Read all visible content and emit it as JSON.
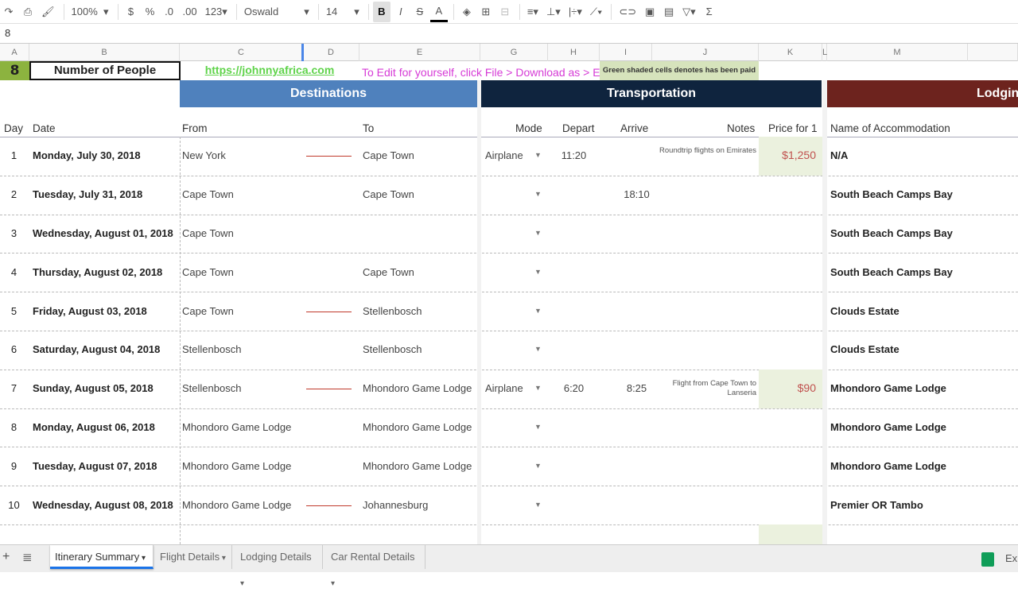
{
  "toolbar": {
    "zoom": "100%",
    "currency": "$",
    "percent": "%",
    "dec_less": ".0",
    "dec_more": ".00",
    "format": "123",
    "font": "Oswald",
    "size": "14",
    "bold": "B",
    "italic": "I",
    "strike": "S",
    "textcolor": "A",
    "sum": "Σ"
  },
  "formula_bar": {
    "value": "8"
  },
  "columns": [
    "A",
    "B",
    "C",
    "D",
    "E",
    "G",
    "H",
    "I",
    "J",
    "K",
    "L",
    "M"
  ],
  "top_row": {
    "people_count": "8",
    "people_label": "Number of People",
    "link": "https://johnnyafrica.com",
    "edit_note": "To Edit for yourself, click File > Download as > Excel",
    "paid_note": "Green shaded cells denotes has been paid"
  },
  "banners": {
    "destinations": "Destinations",
    "transportation": "Transportation",
    "lodging": "Lodging"
  },
  "colors": {
    "destinations": "#4f81bd",
    "transportation": "#0f243e",
    "lodging": "#6d231e",
    "paid": "#ebf1de",
    "price": "#c0504d",
    "people_cell": "#8cb33f"
  },
  "headers": {
    "day": "Day",
    "date": "Date",
    "from": "From",
    "to": "To",
    "mode": "Mode",
    "depart": "Depart",
    "arrive": "Arrive",
    "notes": "Notes",
    "price": "Price for 1",
    "accommodation": "Name of Accommodation"
  },
  "rows": [
    {
      "day": "1",
      "date": "Monday, July 30, 2018",
      "from": "New York",
      "to": "Cape Town",
      "travel": true,
      "mode": "Airplane",
      "depart": "11:20",
      "arrive": "",
      "notes": "Roundtrip flights on Emirates",
      "price": "$1,250",
      "paid": true,
      "lodging": "N/A"
    },
    {
      "day": "2",
      "date": "Tuesday, July 31, 2018",
      "from": "Cape Town",
      "to": "Cape Town",
      "travel": false,
      "mode": "",
      "depart": "",
      "arrive": "18:10",
      "notes": "",
      "price": "",
      "paid": false,
      "lodging": "South Beach Camps Bay"
    },
    {
      "day": "3",
      "date": "Wednesday, August 01, 2018",
      "from": "Cape Town",
      "to": "",
      "travel": false,
      "mode": "",
      "depart": "",
      "arrive": "",
      "notes": "",
      "price": "",
      "paid": false,
      "lodging": "South Beach Camps Bay"
    },
    {
      "day": "4",
      "date": "Thursday, August 02, 2018",
      "from": "Cape Town",
      "to": "Cape Town",
      "travel": false,
      "mode": "",
      "depart": "",
      "arrive": "",
      "notes": "",
      "price": "",
      "paid": false,
      "lodging": "South Beach Camps Bay"
    },
    {
      "day": "5",
      "date": "Friday, August 03, 2018",
      "from": "Cape Town",
      "to": "Stellenbosch",
      "travel": true,
      "mode": "",
      "depart": "",
      "arrive": "",
      "notes": "",
      "price": "",
      "paid": false,
      "lodging": "Clouds Estate"
    },
    {
      "day": "6",
      "date": "Saturday, August 04, 2018",
      "from": "Stellenbosch",
      "to": "Stellenbosch",
      "travel": false,
      "mode": "",
      "depart": "",
      "arrive": "",
      "notes": "",
      "price": "",
      "paid": false,
      "lodging": "Clouds Estate"
    },
    {
      "day": "7",
      "date": "Sunday, August 05, 2018",
      "from": "Stellenbosch",
      "to": "Mhondoro Game Lodge",
      "travel": true,
      "mode": "Airplane",
      "depart": "6:20",
      "arrive": "8:25",
      "notes": "Flight from Cape Town to Lanseria",
      "price": "$90",
      "paid": true,
      "lodging": "Mhondoro Game Lodge"
    },
    {
      "day": "8",
      "date": "Monday, August 06, 2018",
      "from": "Mhondoro Game Lodge",
      "to": "Mhondoro Game Lodge",
      "travel": false,
      "mode": "",
      "depart": "",
      "arrive": "",
      "notes": "",
      "price": "",
      "paid": false,
      "lodging": "Mhondoro Game Lodge"
    },
    {
      "day": "9",
      "date": "Tuesday, August 07, 2018",
      "from": "Mhondoro Game Lodge",
      "to": "Mhondoro Game Lodge",
      "travel": false,
      "mode": "",
      "depart": "",
      "arrive": "",
      "notes": "",
      "price": "",
      "paid": false,
      "lodging": "Mhondoro Game Lodge"
    },
    {
      "day": "10",
      "date": "Wednesday, August 08, 2018",
      "from": "Mhondoro Game Lodge",
      "to": "Johannesburg",
      "travel": true,
      "mode": "",
      "depart": "",
      "arrive": "",
      "notes": "",
      "price": "",
      "paid": false,
      "lodging": "Premier OR Tambo"
    }
  ],
  "tabs": [
    {
      "label": "Itinerary Summary",
      "active": true
    },
    {
      "label": "Flight Details"
    },
    {
      "label": "Lodging Details"
    },
    {
      "label": "Car Rental Details"
    }
  ],
  "explore": "Exp"
}
